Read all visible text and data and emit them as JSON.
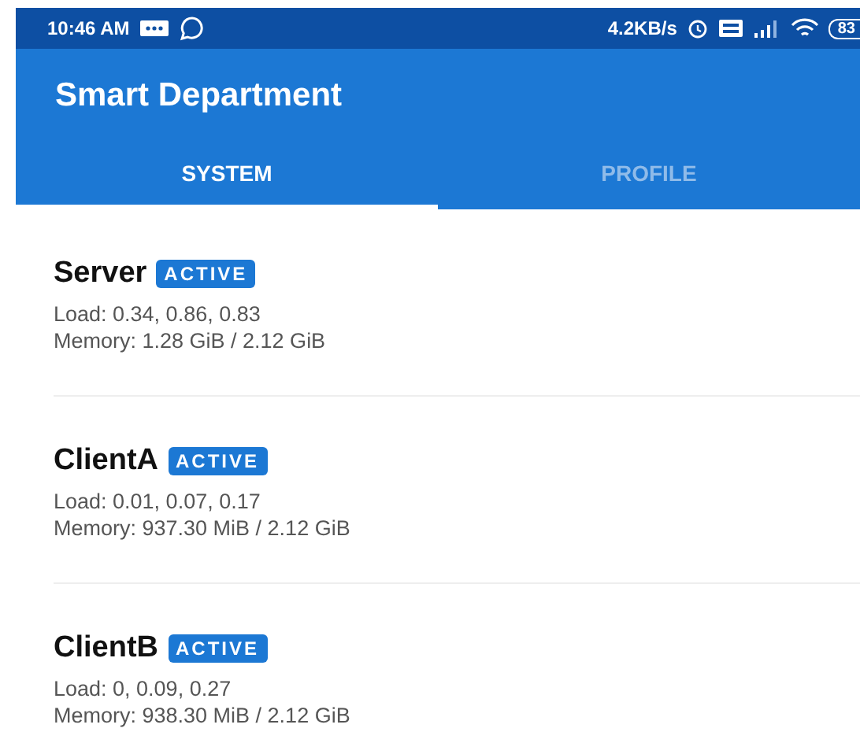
{
  "status_bar": {
    "time": "10:46 AM",
    "speed": "4.2KB/s",
    "battery": "83"
  },
  "app_bar": {
    "title": "Smart Department"
  },
  "tabs": [
    {
      "label": "SYSTEM",
      "selected": true
    },
    {
      "label": "PROFILE",
      "selected": false
    }
  ],
  "machines": [
    {
      "name": "Server",
      "status": "ACTIVE",
      "load": "Load: 0.34, 0.86, 0.83",
      "memory": "Memory: 1.28 GiB / 2.12 GiB"
    },
    {
      "name": "ClientA",
      "status": "ACTIVE",
      "load": "Load: 0.01, 0.07, 0.17",
      "memory": "Memory: 937.30 MiB / 2.12 GiB"
    },
    {
      "name": "ClientB",
      "status": "ACTIVE",
      "load": "Load: 0, 0.09, 0.27",
      "memory": "Memory: 938.30 MiB / 2.12 GiB"
    }
  ]
}
